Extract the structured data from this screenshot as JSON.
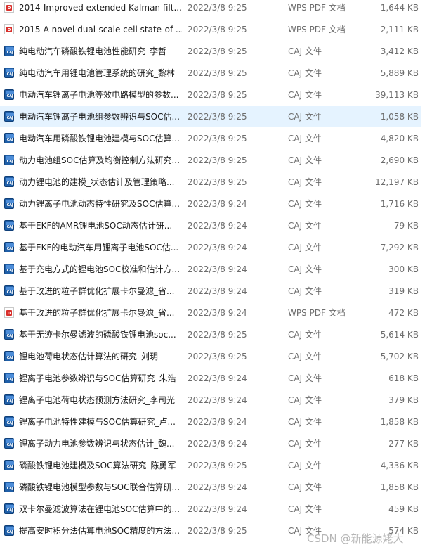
{
  "files": [
    {
      "name": "2014-Improved extended Kalman filt...",
      "date": "2022/3/8 9:25",
      "type": "WPS PDF 文档",
      "size": "1,644 KB",
      "icon": "pdf-icon"
    },
    {
      "name": "2015-A novel dual-scale cell state-of-...",
      "date": "2022/3/8 9:25",
      "type": "WPS PDF 文档",
      "size": "2,111 KB",
      "icon": "pdf-icon"
    },
    {
      "name": "纯电动汽车磷酸铁锂电池性能研究_李哲",
      "date": "2022/3/8 9:25",
      "type": "CAJ 文件",
      "size": "3,412 KB",
      "icon": "caj-icon"
    },
    {
      "name": "纯电动汽车用锂电池管理系统的研究_黎林",
      "date": "2022/3/8 9:25",
      "type": "CAJ 文件",
      "size": "5,889 KB",
      "icon": "caj-icon"
    },
    {
      "name": "电动汽车锂离子电池等效电路模型的参数...",
      "date": "2022/3/8 9:25",
      "type": "CAJ 文件",
      "size": "39,113 KB",
      "icon": "caj-icon"
    },
    {
      "name": "电动汽车锂离子电池组参数辨识与SOC估...",
      "date": "2022/3/8 9:25",
      "type": "CAJ 文件",
      "size": "1,058 KB",
      "icon": "caj-icon",
      "selected": true
    },
    {
      "name": "电动汽车用磷酸铁锂电池建模与SOC估算...",
      "date": "2022/3/8 9:25",
      "type": "CAJ 文件",
      "size": "4,820 KB",
      "icon": "caj-icon"
    },
    {
      "name": "动力电池组SOC估算及均衡控制方法研究...",
      "date": "2022/3/8 9:25",
      "type": "CAJ 文件",
      "size": "2,690 KB",
      "icon": "caj-icon"
    },
    {
      "name": "动力锂电池的建模_状态估计及管理策略...",
      "date": "2022/3/8 9:25",
      "type": "CAJ 文件",
      "size": "12,197 KB",
      "icon": "caj-icon"
    },
    {
      "name": "动力锂离子电池动态特性研究及SOC估算...",
      "date": "2022/3/8 9:24",
      "type": "CAJ 文件",
      "size": "1,716 KB",
      "icon": "caj-icon"
    },
    {
      "name": "基于EKF的AMR锂电池SOC动态估计研...",
      "date": "2022/3/8 9:24",
      "type": "CAJ 文件",
      "size": "79 KB",
      "icon": "caj-icon"
    },
    {
      "name": "基于EKF的电动汽车用锂离子电池SOC估...",
      "date": "2022/3/8 9:24",
      "type": "CAJ 文件",
      "size": "7,292 KB",
      "icon": "caj-icon"
    },
    {
      "name": "基于充电方式的锂电池SOC校准和估计方...",
      "date": "2022/3/8 9:24",
      "type": "CAJ 文件",
      "size": "300 KB",
      "icon": "caj-icon"
    },
    {
      "name": "基于改进的粒子群优化扩展卡尔曼滤_省...",
      "date": "2022/3/8 9:24",
      "type": "CAJ 文件",
      "size": "319 KB",
      "icon": "caj-icon"
    },
    {
      "name": "基于改进的粒子群优化扩展卡尔曼滤_省...",
      "date": "2022/3/8 9:24",
      "type": "WPS PDF 文档",
      "size": "472 KB",
      "icon": "pdf-icon"
    },
    {
      "name": "基于无迹卡尔曼滤波的磷酸铁锂电池soc...",
      "date": "2022/3/8 9:25",
      "type": "CAJ 文件",
      "size": "5,614 KB",
      "icon": "caj-icon"
    },
    {
      "name": "锂电池荷电状态估计算法的研究_刘玥",
      "date": "2022/3/8 9:25",
      "type": "CAJ 文件",
      "size": "5,702 KB",
      "icon": "caj-icon"
    },
    {
      "name": "锂离子电池参数辨识与SOC估算研究_朱浩",
      "date": "2022/3/8 9:24",
      "type": "CAJ 文件",
      "size": "618 KB",
      "icon": "caj-icon"
    },
    {
      "name": "锂离子电池荷电状态预测方法研究_李司光",
      "date": "2022/3/8 9:24",
      "type": "CAJ 文件",
      "size": "379 KB",
      "icon": "caj-icon"
    },
    {
      "name": "锂离子电池特性建模与SOC估算研究_卢...",
      "date": "2022/3/8 9:24",
      "type": "CAJ 文件",
      "size": "1,858 KB",
      "icon": "caj-icon"
    },
    {
      "name": "锂离子动力电池参数辨识与状态估计_魏...",
      "date": "2022/3/8 9:24",
      "type": "CAJ 文件",
      "size": "277 KB",
      "icon": "caj-icon"
    },
    {
      "name": "磷酸铁锂电池建模及SOC算法研究_陈勇军",
      "date": "2022/3/8 9:25",
      "type": "CAJ 文件",
      "size": "4,336 KB",
      "icon": "caj-icon"
    },
    {
      "name": "磷酸铁锂电池模型参数与SOC联合估算研...",
      "date": "2022/3/8 9:24",
      "type": "CAJ 文件",
      "size": "1,858 KB",
      "icon": "caj-icon"
    },
    {
      "name": "双卡尔曼滤波算法在锂电池SOC估算中的...",
      "date": "2022/3/8 9:24",
      "type": "CAJ 文件",
      "size": "459 KB",
      "icon": "caj-icon"
    },
    {
      "name": "提高安时积分法估算电池SOC精度的方法...",
      "date": "2022/3/8 9:25",
      "type": "CAJ 文件",
      "size": "574 KB",
      "icon": "caj-icon"
    }
  ],
  "caj_icon_text": "CAJ",
  "watermark": "CSDN @新能源姥大",
  "colors": {
    "selected_row": "#e5f3ff",
    "caj_blue": "#1f5fa8",
    "pdf_red": "#d9302c",
    "meta_text": "#6d6d6d"
  }
}
